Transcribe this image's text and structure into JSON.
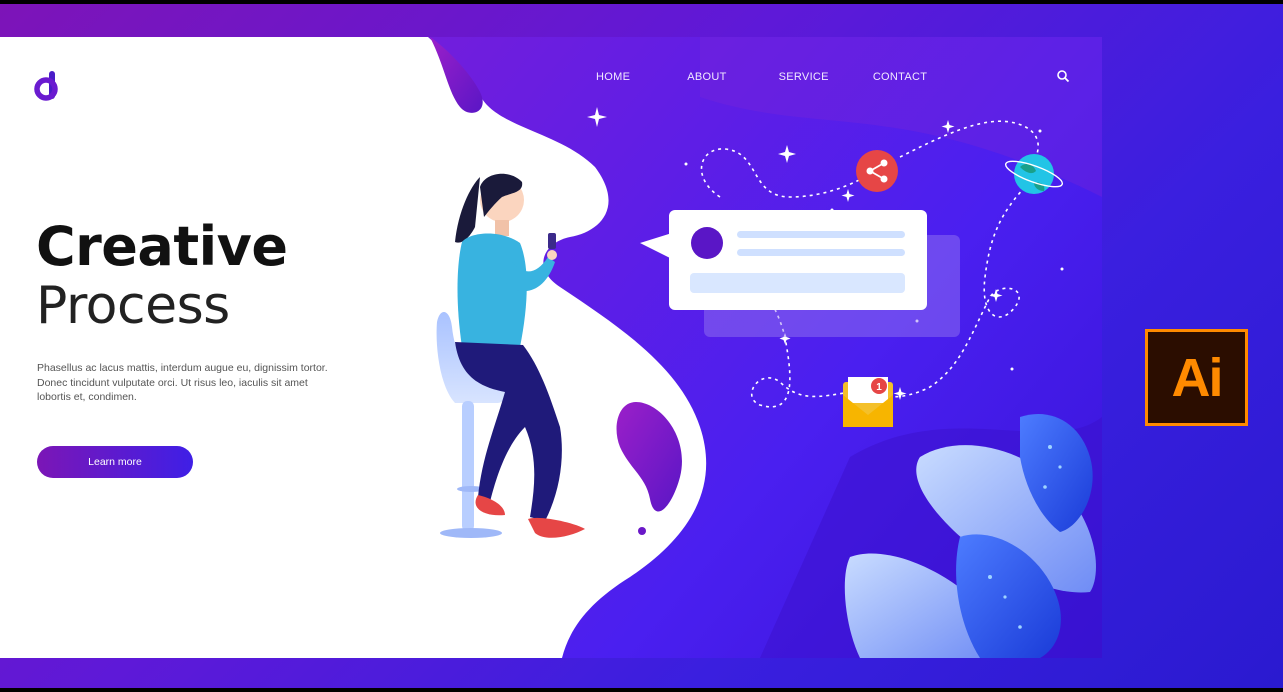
{
  "brand": {
    "logo_letter": "d"
  },
  "nav": {
    "items": [
      "HOME",
      "ABOUT",
      "SERVICE",
      "CONTACT"
    ]
  },
  "hero": {
    "title_bold": "Creative",
    "title_light": "Process",
    "body": "Phasellus ac lacus mattis, interdum augue eu, dignissim tortor. Donec tincidunt vulputate orci. Ut risus leo, iaculis sit amet lobortis et, condimen.",
    "cta_label": "Learn more"
  },
  "notification": {
    "count": "1"
  },
  "badge": {
    "label": "Ai"
  },
  "icons": [
    "search-icon",
    "share-icon",
    "envelope-icon",
    "globe-icon",
    "sparkle-icon"
  ],
  "colors": {
    "accent_purple": "#7b16b6",
    "accent_blue": "#3f1fe6",
    "share_red": "#e64646",
    "badge_orange": "#ff8a00"
  }
}
